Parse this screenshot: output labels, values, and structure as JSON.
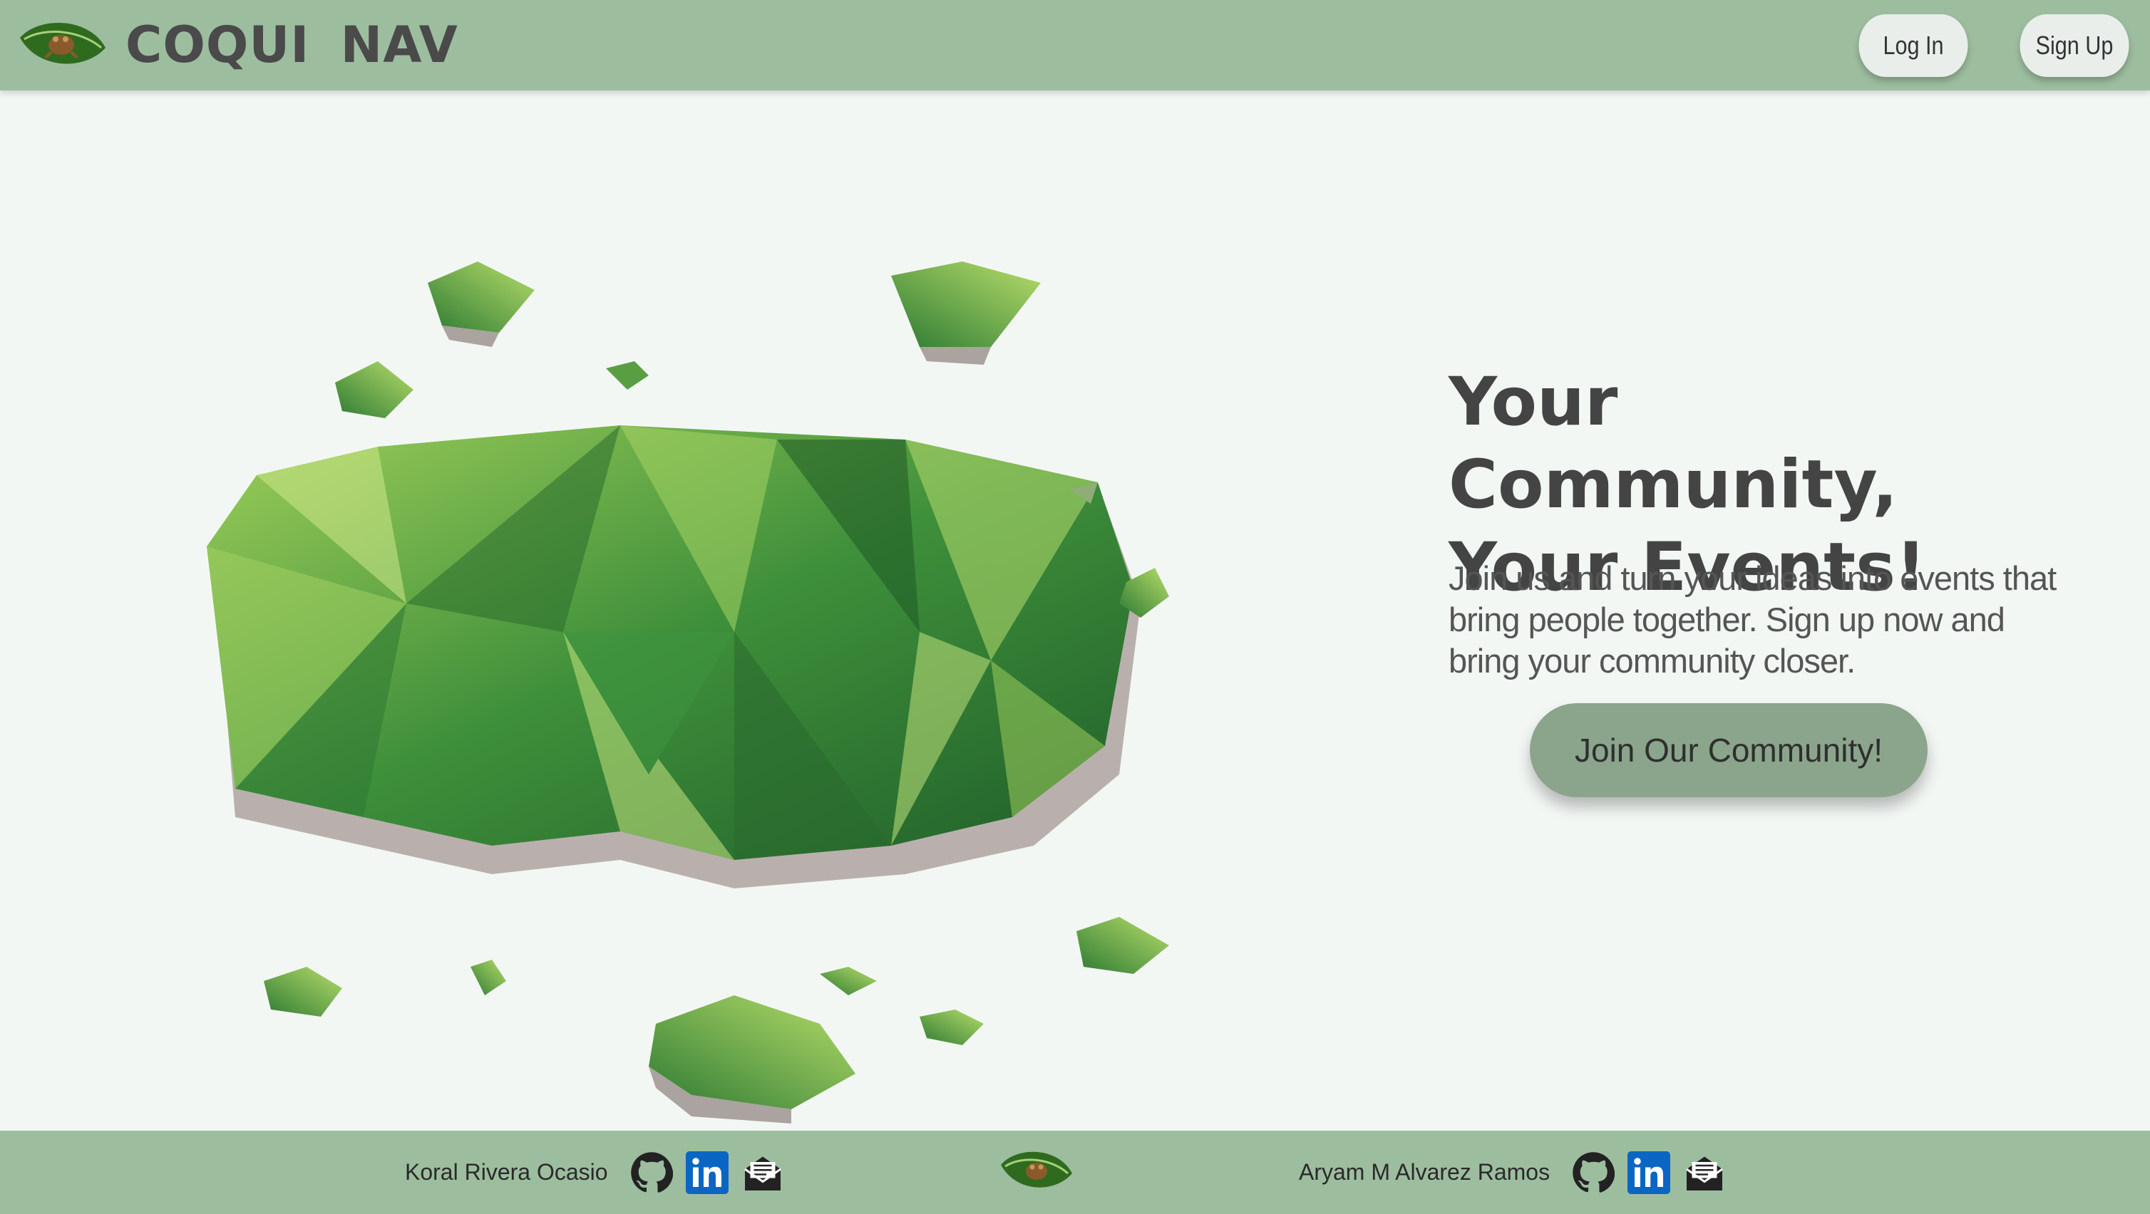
{
  "app": {
    "brand": "COQUI NAV"
  },
  "header": {
    "login_label": "Log In",
    "signup_label": "Sign Up"
  },
  "hero": {
    "title_line1": "Your Community,",
    "title_line2": "Your Events!",
    "subtitle": "Join us and turn your ideas into events that bring people together. Sign up now and bring your community closer.",
    "cta_label": "Join Our Community!"
  },
  "footer": {
    "people": [
      {
        "name": "Koral Rivera Ocasio",
        "icons": [
          "github-icon",
          "linkedin-icon",
          "email-icon"
        ]
      },
      {
        "name": "Aryam M Alvarez Ramos",
        "icons": [
          "github-icon",
          "linkedin-icon",
          "email-icon"
        ]
      }
    ]
  },
  "colors": {
    "header_bg": "#9dbd9f",
    "page_bg": "#f3f7f4",
    "cta_bg": "#8aa58b",
    "text_dark": "#444444",
    "linkedin_blue": "#0a66c2"
  }
}
